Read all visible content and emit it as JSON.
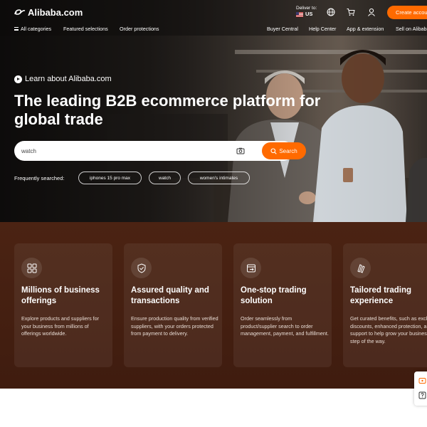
{
  "header": {
    "logo_text": "Alibaba.com",
    "deliver_label": "Deliver to:",
    "deliver_country": "US",
    "create_account_label": "Create account"
  },
  "nav": {
    "all_categories": "All categories",
    "featured_selections": "Featured selections",
    "order_protections": "Order protections",
    "buyer_central": "Buyer Central",
    "help_center": "Help Center",
    "app_extension": "App & extension",
    "sell_on": "Sell on Alibaba"
  },
  "hero": {
    "learn_link": "Learn about Alibaba.com",
    "headline": "The leading B2B ecommerce platform for global trade",
    "search_value": "watch",
    "search_button": "Search",
    "frequently_label": "Frequently searched:",
    "chips": [
      "iphones 15 pro max",
      "watch",
      "women's intimates"
    ]
  },
  "features": [
    {
      "icon": "grid-icon",
      "title": "Millions of business offerings",
      "desc": "Explore products and suppliers for your business from millions of offerings worldwide."
    },
    {
      "icon": "shield-check-icon",
      "title": "Assured quality and transactions",
      "desc": "Ensure production quality from verified suppliers, with your orders protected from payment to delivery."
    },
    {
      "icon": "one-stop-icon",
      "title": "One-stop trading solution",
      "desc": "Order seamlessly from product/supplier search to order management, payment, and fulfillment."
    },
    {
      "icon": "tailored-icon",
      "title": "Tailored trading experience",
      "desc": "Get curated benefits, such as exclusive discounts, enhanced protection, and extra support to help grow your business every step of the way."
    }
  ],
  "colors": {
    "accent": "#ff6a00",
    "brown_section": "#441f11"
  }
}
